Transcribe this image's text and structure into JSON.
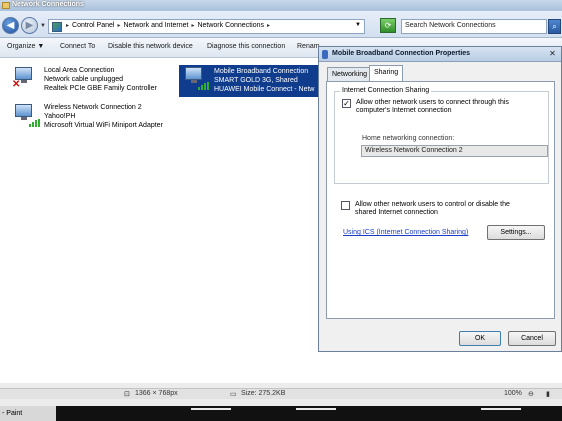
{
  "window_title": "Network Connections",
  "address": {
    "crumbs": [
      "Control Panel",
      "Network and Internet",
      "Network Connections"
    ],
    "search_placeholder": "Search Network Connections"
  },
  "toolbar": {
    "organize": "Organize ▼",
    "connect_to": "Connect To",
    "disable": "Disable this network device",
    "diagnose": "Diagnose this connection",
    "rename": "Renam"
  },
  "connections": {
    "lan": {
      "name": "Local Area Connection",
      "status": "Network cable unplugged",
      "adapter": "Realtek PCIe GBE Family Controller"
    },
    "mobile": {
      "name": "Mobile Broadband Connection",
      "status": "SMART GOLD 3G, Shared",
      "adapter": "HUAWEI Mobile Connect - Netw"
    },
    "wireless": {
      "name": "Wireless Network Connection 2",
      "status": "Yahoo!PH",
      "adapter": "Microsoft Virtual WiFi Miniport Adapter"
    }
  },
  "dialog": {
    "title": "Mobile Broadband Connection Properties",
    "tabs": [
      "Networking",
      "Sharing"
    ],
    "active_tab": "Sharing",
    "group_title": "Internet Connection Sharing",
    "allow_connect_line1": "Allow other network users to connect through this",
    "allow_connect_line2": "computer's Internet connection",
    "allow_connect_checked": true,
    "home_label": "Home networking connection:",
    "home_value": "Wireless Network Connection 2",
    "allow_control_line1": "Allow other network users to control or disable the",
    "allow_control_line2": "shared Internet connection",
    "allow_control_checked": false,
    "ics_link": "Using ICS (Internet Connection Sharing)",
    "settings_button": "Settings...",
    "ok_button": "OK",
    "cancel_button": "Cancel"
  },
  "statusbar": {
    "dimensions": "1366 × 768px",
    "size": "Size: 275.2KB",
    "zoom": "100%"
  },
  "taskbar": {
    "paint": "- Paint"
  },
  "colors": {
    "selection": "#0f3c8c",
    "link": "#1a3cc4"
  }
}
